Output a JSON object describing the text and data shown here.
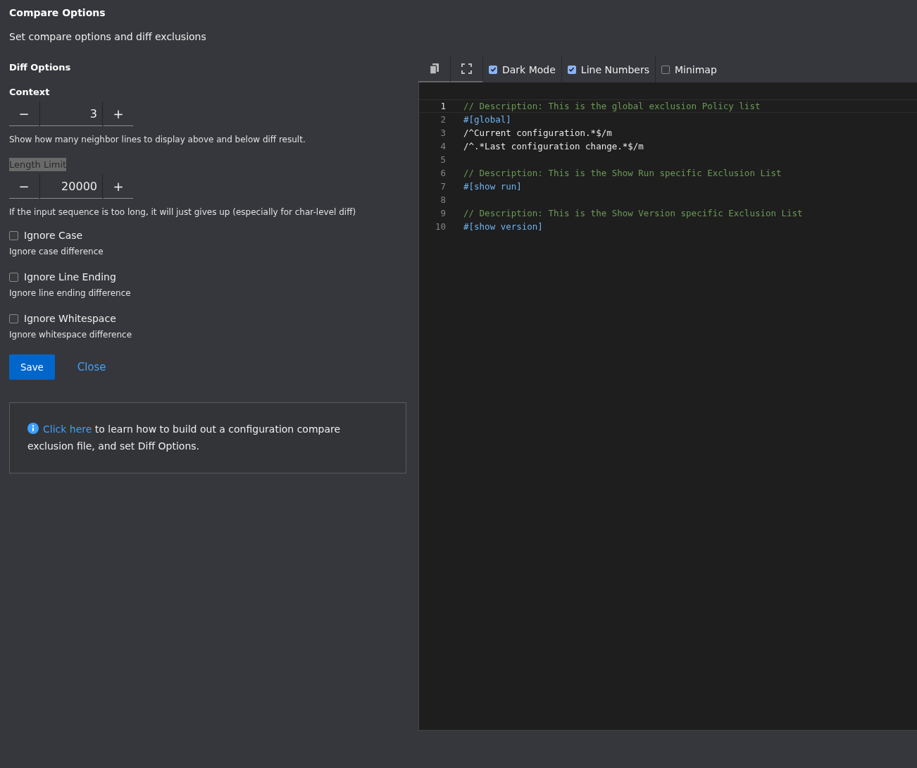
{
  "header": {
    "title": "Compare Options",
    "subtitle": "Set compare options and diff exclusions"
  },
  "diff_options": {
    "heading": "Diff Options",
    "numeric_fields": [
      {
        "label": "Context",
        "value": "3",
        "decrement": "−",
        "increment": "+",
        "description": "Show how many neighbor lines to display above and below diff result.",
        "highlighted": false
      },
      {
        "label": "Length Limit",
        "value": "20000",
        "decrement": "−",
        "increment": "+",
        "description": "If the input sequence is too long, it will just gives up (especially for char-level diff)",
        "highlighted": true
      }
    ],
    "checkboxes": [
      {
        "label": "Ignore Case",
        "description": "Ignore case difference",
        "checked": false
      },
      {
        "label": "Ignore Line Ending",
        "description": "Ignore line ending difference",
        "checked": false
      },
      {
        "label": "Ignore Whitespace",
        "description": "Ignore whitespace difference",
        "checked": false
      }
    ]
  },
  "buttons": {
    "save": "Save",
    "close": "Close"
  },
  "info": {
    "link": "Click here",
    "text": "to learn how to build out a configuration compare exclusion file, and set Diff Options."
  },
  "editor": {
    "toggles": [
      {
        "label": "Dark Mode",
        "checked": true
      },
      {
        "label": "Line Numbers",
        "checked": true
      },
      {
        "label": "Minimap",
        "checked": false
      }
    ],
    "lines": [
      {
        "number": "1",
        "text": "// Description: This is the global exclusion Policy list",
        "kind": "comment",
        "active": true
      },
      {
        "number": "2",
        "text": "#[global]",
        "kind": "section",
        "active": false
      },
      {
        "number": "3",
        "text": "/^Current configuration.*$/m",
        "kind": "plain",
        "active": false
      },
      {
        "number": "4",
        "text": "/^.*Last configuration change.*$/m",
        "kind": "plain",
        "active": false
      },
      {
        "number": "5",
        "active": false
      },
      {
        "number": "6",
        "text": "// Description: This is the Show Run specific Exclusion List",
        "kind": "comment",
        "active": false
      },
      {
        "number": "7",
        "text": "#[show run]",
        "kind": "section",
        "active": false
      },
      {
        "number": "8",
        "active": false
      },
      {
        "number": "9",
        "text": "// Description: This is the Show Version specific Exclusion List",
        "kind": "comment",
        "active": false
      },
      {
        "number": "10",
        "text": "#[show version]",
        "kind": "section",
        "active": false
      }
    ]
  }
}
